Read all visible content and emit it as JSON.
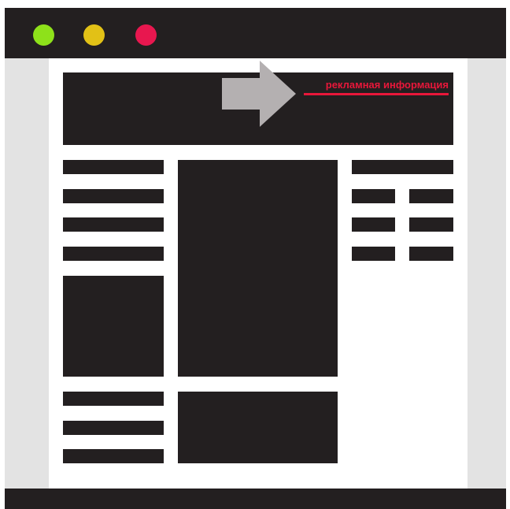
{
  "window": {
    "controls": [
      {
        "name": "green-dot-icon",
        "color": "#8ee11a"
      },
      {
        "name": "yellow-dot-icon",
        "color": "#e2c116"
      },
      {
        "name": "red-dot-icon",
        "color": "#e8174f"
      }
    ]
  },
  "banner": {
    "ad_label": "рекламная информация",
    "label_color": "#e8173a",
    "arrow_color": "#b4b0b1"
  },
  "colors": {
    "block": "#231f20",
    "side_gutter": "#e3e3e3",
    "page": "#ffffff"
  }
}
